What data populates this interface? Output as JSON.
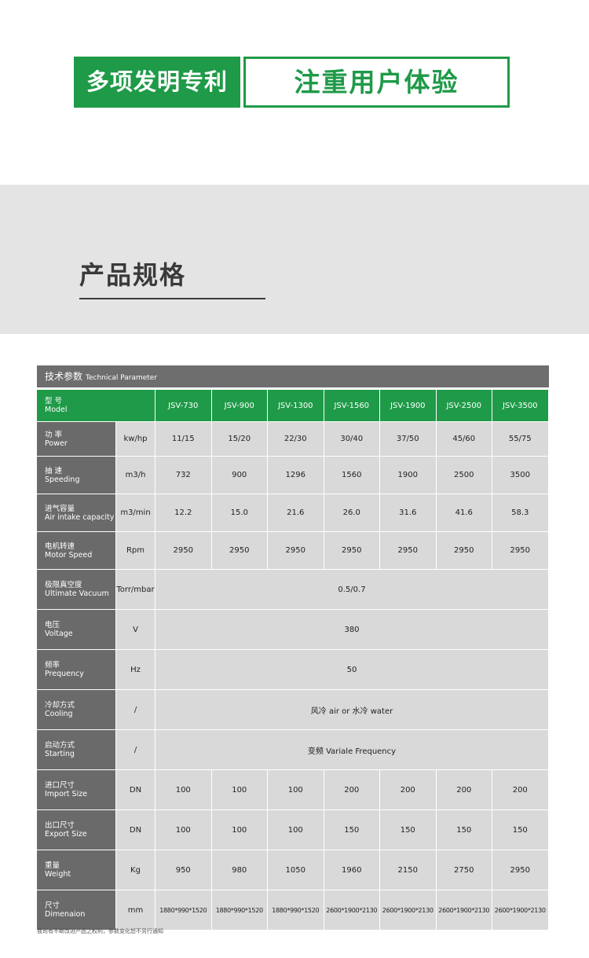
{
  "banner": {
    "left": "多项发明专利",
    "right": "注重用户体验"
  },
  "spec": {
    "title": "产品规格"
  },
  "table": {
    "header_cn": "技术参数",
    "header_en": "Technical Parameter",
    "model_label_cn": "型 号",
    "model_label_en": "Model",
    "models": [
      "JSV-730",
      "JSV-900",
      "JSV-1300",
      "JSV-1560",
      "JSV-1900",
      "JSV-2500",
      "JSV-3500"
    ],
    "rows": [
      {
        "cn": "功 率",
        "en": "Power",
        "unit": "kw/hp",
        "values": [
          "11/15",
          "15/20",
          "22/30",
          "30/40",
          "37/50",
          "45/60",
          "55/75"
        ]
      },
      {
        "cn": "抽 速",
        "en": "Speeding",
        "unit": "m3/h",
        "values": [
          "732",
          "900",
          "1296",
          "1560",
          "1900",
          "2500",
          "3500"
        ]
      },
      {
        "cn": "进气容量",
        "en": "Air intake capacity",
        "unit": "m3/min",
        "values": [
          "12.2",
          "15.0",
          "21.6",
          "26.0",
          "31.6",
          "41.6",
          "58.3"
        ]
      },
      {
        "cn": "电机转速",
        "en": "Motor Speed",
        "unit": "Rpm",
        "values": [
          "2950",
          "2950",
          "2950",
          "2950",
          "2950",
          "2950",
          "2950"
        ]
      },
      {
        "cn": "极限真空度",
        "en": "Ultimate Vacuum",
        "unit": "Torr/mbar",
        "merged": "0.5/0.7"
      },
      {
        "cn": "电压",
        "en": "Voltage",
        "unit": "V",
        "merged": "380"
      },
      {
        "cn": "频率",
        "en": "Prequency",
        "unit": "Hz",
        "merged": "50"
      },
      {
        "cn": "冷却方式",
        "en": "Cooling",
        "unit": "/",
        "merged": "风冷 air or 水冷 water"
      },
      {
        "cn": "启动方式",
        "en": "Starting",
        "unit": "/",
        "merged": "变频  Variale Frequency"
      },
      {
        "cn": "进口尺寸",
        "en": "Import Size",
        "unit": "DN",
        "values": [
          "100",
          "100",
          "100",
          "200",
          "200",
          "200",
          "200"
        ]
      },
      {
        "cn": "出口尺寸",
        "en": "Export Size",
        "unit": "DN",
        "values": [
          "100",
          "100",
          "100",
          "150",
          "150",
          "150",
          "150"
        ]
      },
      {
        "cn": "重量",
        "en": "Weight",
        "unit": "Kg",
        "values": [
          "950",
          "980",
          "1050",
          "1960",
          "2150",
          "2750",
          "2950"
        ]
      },
      {
        "cn": "尺寸",
        "en": "Dimenaion",
        "unit": "mm",
        "values": [
          "1880*990*1520",
          "1880*990*1520",
          "1880*990*1520",
          "2600*1900*2130",
          "2600*1900*2130",
          "2600*1900*2130",
          "2600*1900*2130"
        ]
      }
    ]
  },
  "footnote": "我司有不断改进产品之权利，参数变化恕不另行通知",
  "colors": {
    "brand_green": "#1f9a48",
    "row_header_gray": "#6a6a6a",
    "cell_gray": "#d9d9d9"
  }
}
